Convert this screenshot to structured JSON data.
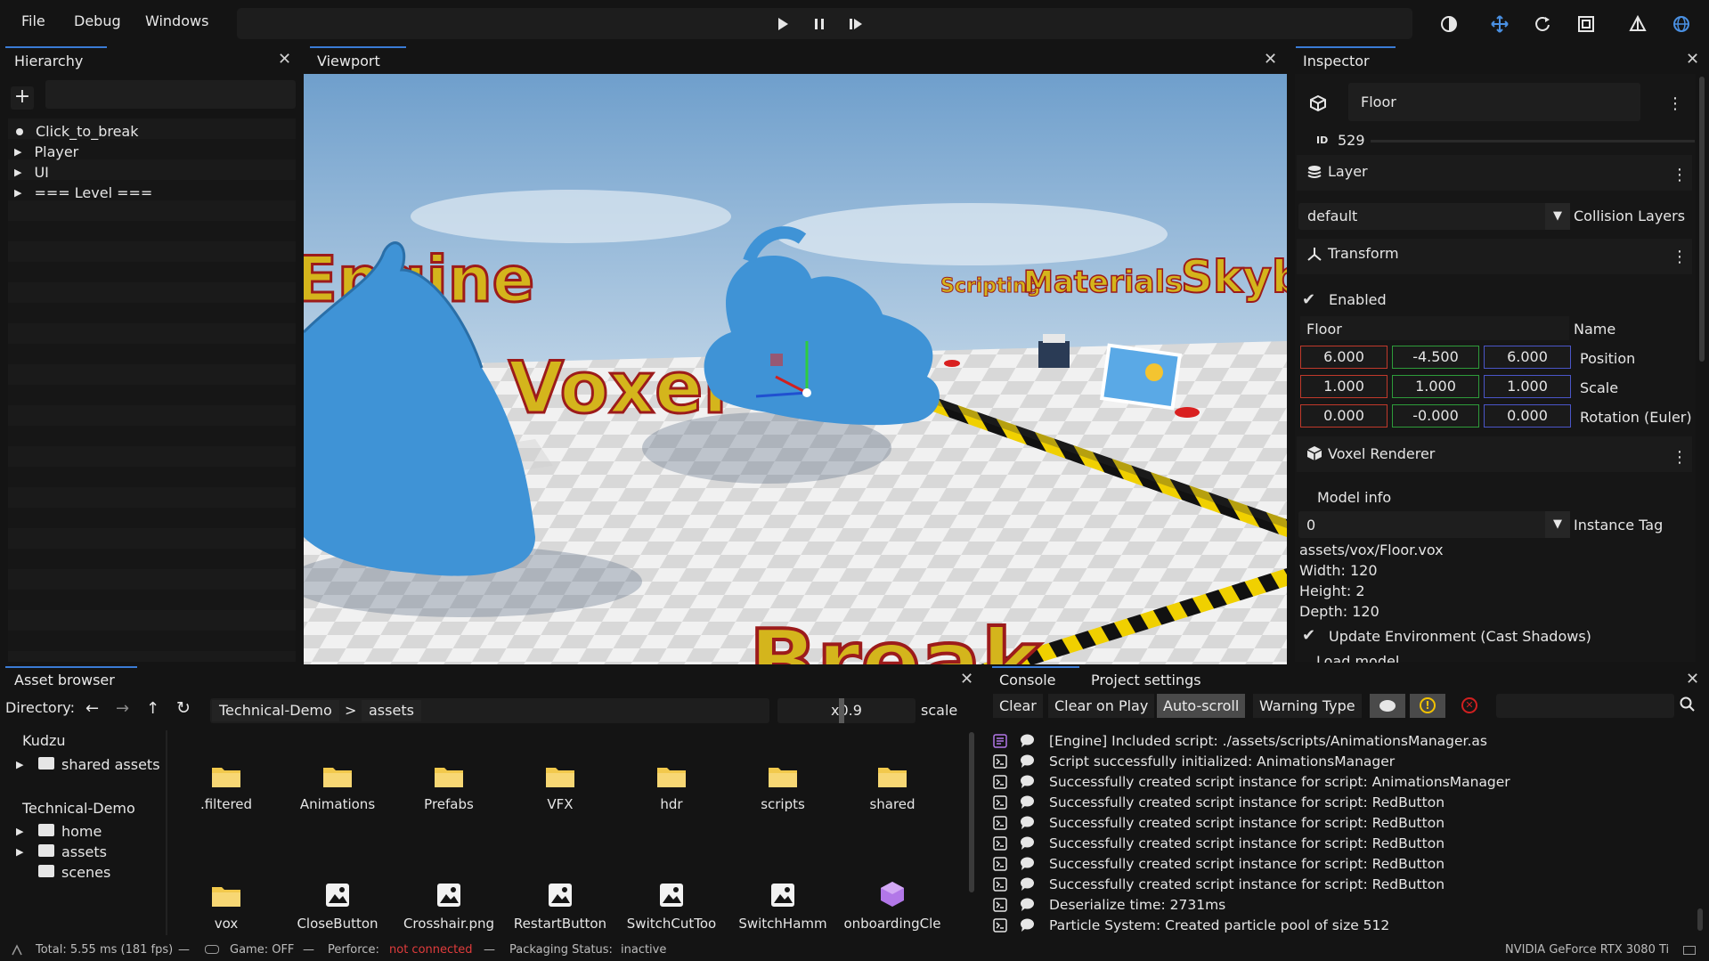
{
  "menu": {
    "file": "File",
    "debug": "Debug",
    "windows": "Windows"
  },
  "hierarchy": {
    "tab": "Hierarchy",
    "items": [
      {
        "label": "Click_to_break",
        "marker": "dot"
      },
      {
        "label": "Player",
        "marker": "arrow"
      },
      {
        "label": "UI",
        "marker": "arrow"
      },
      {
        "label": "=== Level ===",
        "marker": "arrow"
      }
    ]
  },
  "viewport": {
    "tab": "Viewport",
    "scene_text": {
      "engine": "Engine",
      "voxel": "Voxel",
      "scripting": "Scripting",
      "materials": "Materials",
      "skybox": "Skyb",
      "break": "Break"
    }
  },
  "inspector": {
    "tab": "Inspector",
    "object_name": "Floor",
    "id_label": "ID",
    "id": "529",
    "layer": {
      "title": "Layer",
      "value": "default",
      "collision_label": "Collision Layers"
    },
    "transform": {
      "title": "Transform",
      "enabled_label": "Enabled",
      "name_value": "Floor",
      "name_label": "Name",
      "position": [
        "6.000",
        "-4.500",
        "6.000"
      ],
      "position_label": "Position",
      "scale": [
        "1.000",
        "1.000",
        "1.000"
      ],
      "scale_label": "Scale",
      "rotation": [
        "0.000",
        "-0.000",
        "0.000"
      ],
      "rotation_label": "Rotation (Euler)"
    },
    "voxel_renderer": {
      "title": "Voxel Renderer",
      "model_info": "Model info",
      "instance_tag_value": "0",
      "instance_tag_label": "Instance Tag",
      "path": "assets/vox/Floor.vox",
      "width": "Width: 120",
      "height": "Height: 2",
      "depth": "Depth: 120",
      "update_env": "Update Environment (Cast Shadows)",
      "load_model": "Load model"
    },
    "colors": {
      "x": "#c0392b",
      "y": "#2e9b3a",
      "z": "#4a55c8"
    }
  },
  "asset_browser": {
    "tab": "Asset browser",
    "directory_label": "Directory:",
    "breadcrumb": [
      "Technical-Demo",
      "assets"
    ],
    "breadcrumb_sep": ">",
    "scale_value": "x0.9",
    "scale_label": "scale",
    "tree": {
      "kudzu": "Kudzu",
      "shared_assets": "shared assets",
      "technical_demo": "Technical-Demo",
      "home": "home",
      "assets": "assets",
      "scenes": "scenes"
    },
    "items": [
      {
        "name": ".filtered",
        "icon": "folder-icon"
      },
      {
        "name": "Animations",
        "icon": "folder-icon"
      },
      {
        "name": "Prefabs",
        "icon": "folder-icon"
      },
      {
        "name": "VFX",
        "icon": "folder-icon"
      },
      {
        "name": "hdr",
        "icon": "folder-icon"
      },
      {
        "name": "scripts",
        "icon": "folder-icon"
      },
      {
        "name": "shared",
        "icon": "folder-icon"
      },
      {
        "name": "vox",
        "icon": "folder-icon"
      },
      {
        "name": "CloseButton",
        "icon": "image-icon"
      },
      {
        "name": "Crosshair.png",
        "icon": "image-icon"
      },
      {
        "name": "RestartButton",
        "icon": "image-icon"
      },
      {
        "name": "SwitchCutToo",
        "icon": "image-icon"
      },
      {
        "name": "SwitchHamm",
        "icon": "image-icon"
      },
      {
        "name": "onboardingCle",
        "icon": "cube-icon"
      }
    ]
  },
  "console": {
    "tab": "Console",
    "tab2": "Project settings",
    "buttons": {
      "clear": "Clear",
      "clear_on_play": "Clear on Play",
      "auto_scroll": "Auto-scroll",
      "warning_type": "Warning Type"
    },
    "lines": [
      {
        "text": "[Engine] Included script: ./assets/scripts/AnimationsManager.as",
        "type": "engine"
      },
      {
        "text": "Script successfully initialized: AnimationsManager",
        "type": "script"
      },
      {
        "text": "Successfully created script instance for script: AnimationsManager",
        "type": "script"
      },
      {
        "text": "Successfully created script instance for script: RedButton",
        "type": "script"
      },
      {
        "text": "Successfully created script instance for script: RedButton",
        "type": "script"
      },
      {
        "text": "Successfully created script instance for script: RedButton",
        "type": "script"
      },
      {
        "text": "Successfully created script instance for script: RedButton",
        "type": "script"
      },
      {
        "text": "Successfully created script instance for script: RedButton",
        "type": "script"
      },
      {
        "text": "Deserialize time: 2731ms",
        "type": "script"
      },
      {
        "text": "Particle System: Created particle pool of size 512",
        "type": "script"
      }
    ]
  },
  "status": {
    "total": "Total: 5.55 ms (181 fps)",
    "sep": "—",
    "game": "Game: OFF",
    "perforce_label": "Perforce:",
    "perforce_value": "not connected",
    "packaging": "Packaging Status:",
    "packaging_value": "inactive",
    "gpu": "NVIDIA GeForce RTX 3080 Ti"
  }
}
